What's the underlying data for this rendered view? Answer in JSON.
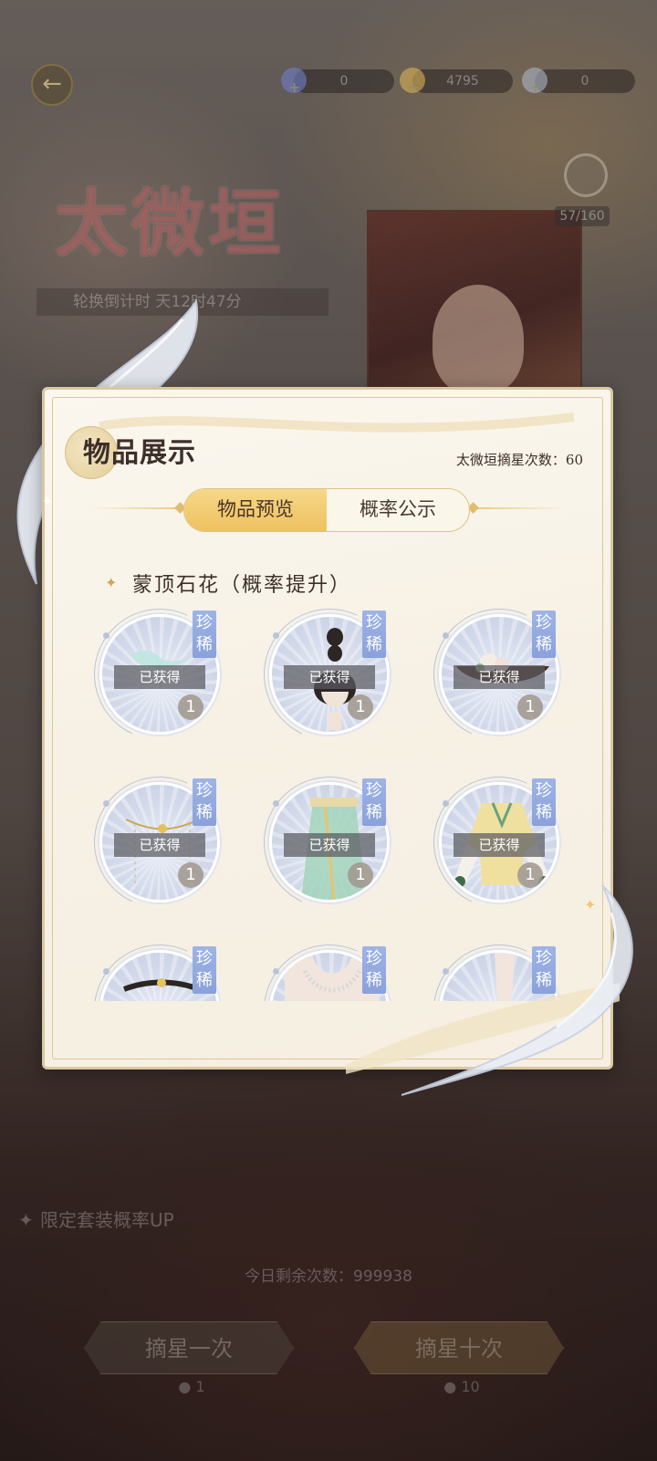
{
  "header": {
    "back_icon": "arrow-left-icon",
    "currencies": [
      {
        "name": "blue-gem",
        "value": "0",
        "color": "#6f7fc9"
      },
      {
        "name": "gold-coin",
        "value": "4795",
        "color": "#d9b256"
      },
      {
        "name": "silver-pearl",
        "value": "0",
        "color": "#aab5c8"
      }
    ]
  },
  "banner": {
    "title": "太微垣",
    "timer": "轮换倒计时 天12时47分",
    "progress": "57/160"
  },
  "modal": {
    "title": "物品展示",
    "pull_count": "太微垣摘星次数：60",
    "tabs": [
      {
        "label": "物品预览",
        "active": true
      },
      {
        "label": "概率公示",
        "active": false
      }
    ],
    "section_title": "蒙顶石花（概率提升）",
    "items": [
      {
        "art": "jade-hairpin",
        "rarity": "珍稀",
        "owned_label": "已获得",
        "qty": "1"
      },
      {
        "art": "hairstyle",
        "rarity": "珍稀",
        "owned_label": "已获得",
        "qty": "1"
      },
      {
        "art": "flower-boat",
        "rarity": "珍稀",
        "owned_label": "已获得",
        "qty": "1"
      },
      {
        "art": "bead-veil",
        "rarity": "珍稀",
        "owned_label": "已获得",
        "qty": "1"
      },
      {
        "art": "green-skirt",
        "rarity": "珍稀",
        "owned_label": "已获得",
        "qty": "1"
      },
      {
        "art": "yellow-robe",
        "rarity": "珍稀",
        "owned_label": "已获得",
        "qty": "1"
      },
      {
        "art": "headband",
        "rarity": "珍稀",
        "owned_label": "",
        "qty": ""
      },
      {
        "art": "pearl-necklace",
        "rarity": "珍稀",
        "owned_label": "",
        "qty": ""
      },
      {
        "art": "leg",
        "rarity": "珍稀",
        "owned_label": "",
        "qty": ""
      }
    ]
  },
  "footer": {
    "up_text": "限定套装概率UP",
    "remaining": "今日剩余次数：999938",
    "draw_one": {
      "label": "摘星一次",
      "cost": "1"
    },
    "draw_ten": {
      "label": "摘星十次",
      "cost": "10"
    }
  },
  "colors": {
    "tab_active": "#eec160",
    "rarity_tag": "#8aa1da",
    "modal_bg": "#f7f1e5",
    "accent_gold": "#d9c7a2"
  }
}
